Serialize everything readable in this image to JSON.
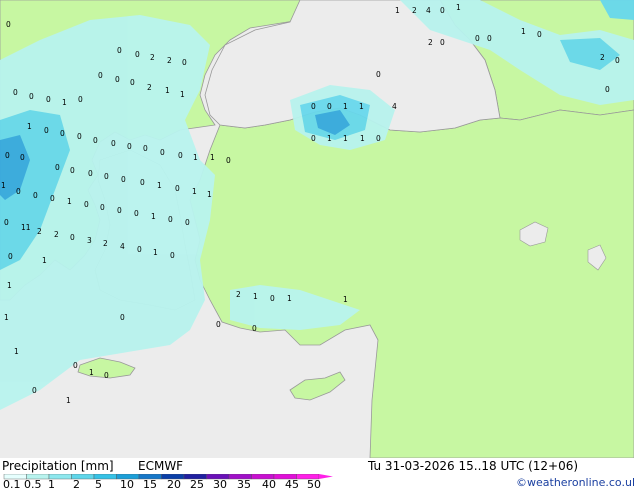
{
  "map": {
    "precip_labels": [
      "0",
      "1",
      "2",
      "4",
      "0",
      "1",
      "2",
      "0",
      "0",
      "0",
      "1",
      "0",
      "2",
      "0",
      "0",
      "0",
      "0",
      "2",
      "2",
      "0",
      "0",
      "0",
      "0",
      "2",
      "1",
      "1",
      "0",
      "0",
      "0",
      "0",
      "1",
      "0",
      "0",
      "0",
      "1",
      "1",
      "4",
      "1",
      "0",
      "0",
      "0",
      "0",
      "0",
      "0",
      "0",
      "0",
      "0",
      "1",
      "1",
      "0",
      "0",
      "1",
      "1",
      "1",
      "0",
      "0",
      "0",
      "0",
      "0",
      "0",
      "0",
      "0",
      "0",
      "1",
      "0",
      "1",
      "1",
      "1",
      "0",
      "0",
      "0",
      "1",
      "0",
      "0",
      "0",
      "0",
      "1",
      "0",
      "0",
      "0",
      "11",
      "2",
      "2",
      "0",
      "3",
      "2",
      "4",
      "0",
      "1",
      "0",
      "0",
      "1",
      "1",
      "2",
      "1",
      "0",
      "1",
      "1",
      "1",
      "0",
      "0",
      "1",
      "0",
      "1",
      "0",
      "0",
      "1",
      "0",
      "1",
      "0"
    ],
    "colors": {
      "sea": "#ececec",
      "land_no_data": "#f0f0f0",
      "land": "#c7f7a2",
      "precip_light": "#b8f3ee",
      "precip_medium": "#68d8ec",
      "precip_heavy": "#36a8e0",
      "coast": "#999999"
    }
  },
  "legend": {
    "title": "Precipitation [mm]",
    "model": "ECMWF",
    "datetime": "Tu 31-03-2026 15..18 UTC (12+06)",
    "credit": "©weatheronline.co.uk",
    "scale_labels": [
      "0.1",
      "0.5",
      "1",
      "2",
      "5",
      "10",
      "15",
      "20",
      "25",
      "30",
      "35",
      "40",
      "45",
      "50"
    ],
    "scale_colors": [
      "#e6fffe",
      "#b8f3ee",
      "#8ee8ee",
      "#5fd6ea",
      "#36c2e6",
      "#1c9fd8",
      "#1677c8",
      "#0a3fa8",
      "#2020a0",
      "#6a10b8",
      "#a010c8",
      "#c810d0",
      "#e010d8",
      "#ff20e8"
    ]
  }
}
